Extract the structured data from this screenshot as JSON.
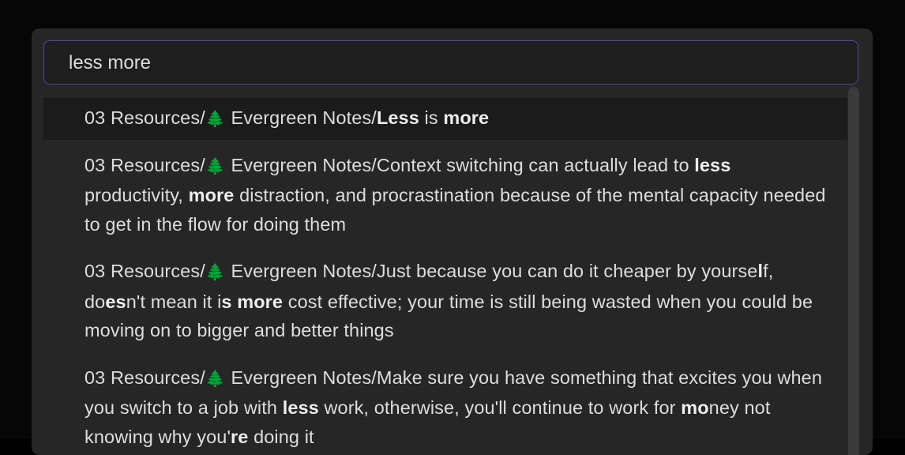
{
  "search": {
    "value": "less more",
    "placeholder": ""
  },
  "results": [
    {
      "selected": true,
      "segments": [
        {
          "t": "03 Resources/",
          "b": false
        },
        {
          "icon": "evergreen-tree-icon",
          "glyph": "🌲"
        },
        {
          "t": " Evergreen Notes/",
          "b": false
        },
        {
          "t": "Less",
          "b": true
        },
        {
          "t": " is ",
          "b": false
        },
        {
          "t": "more",
          "b": true
        }
      ]
    },
    {
      "selected": false,
      "segments": [
        {
          "t": "03 Resources/",
          "b": false
        },
        {
          "icon": "evergreen-tree-icon",
          "glyph": "🌲"
        },
        {
          "t": " Evergreen Notes/Context switching can actually lead to ",
          "b": false
        },
        {
          "t": "less",
          "b": true
        },
        {
          "t": " productivity, ",
          "b": false
        },
        {
          "t": "more",
          "b": true
        },
        {
          "t": " distraction, and procrastination because of the mental capacity needed to get in the flow for doing them",
          "b": false
        }
      ]
    },
    {
      "selected": false,
      "segments": [
        {
          "t": "03 Resources/",
          "b": false
        },
        {
          "icon": "evergreen-tree-icon",
          "glyph": "🌲"
        },
        {
          "t": " Evergreen Notes/Just because you can do it cheaper by yourse",
          "b": false
        },
        {
          "t": "l",
          "b": true
        },
        {
          "t": "f, do",
          "b": false
        },
        {
          "t": "es",
          "b": true
        },
        {
          "t": "n't mean it i",
          "b": false
        },
        {
          "t": "s more",
          "b": true
        },
        {
          "t": " cost effective; your time is still being wasted when you could be moving on to bigger and better things",
          "b": false
        }
      ]
    },
    {
      "selected": false,
      "segments": [
        {
          "t": "03 Resources/",
          "b": false
        },
        {
          "icon": "evergreen-tree-icon",
          "glyph": "🌲"
        },
        {
          "t": " Evergreen Notes/Make sure you have something that excites you when you switch to a job with ",
          "b": false
        },
        {
          "t": "less",
          "b": true
        },
        {
          "t": " work, otherwise, you'll continue to work for ",
          "b": false
        },
        {
          "t": "mo",
          "b": true
        },
        {
          "t": "ney not knowing why you'",
          "b": false
        },
        {
          "t": "re",
          "b": true
        },
        {
          "t": " doing it",
          "b": false
        }
      ]
    }
  ],
  "colors": {
    "background": "#000000",
    "modal": "#262626",
    "selected_row": "#1b1b1b",
    "input_border": "#4d4a9a",
    "text": "#dcddde"
  }
}
